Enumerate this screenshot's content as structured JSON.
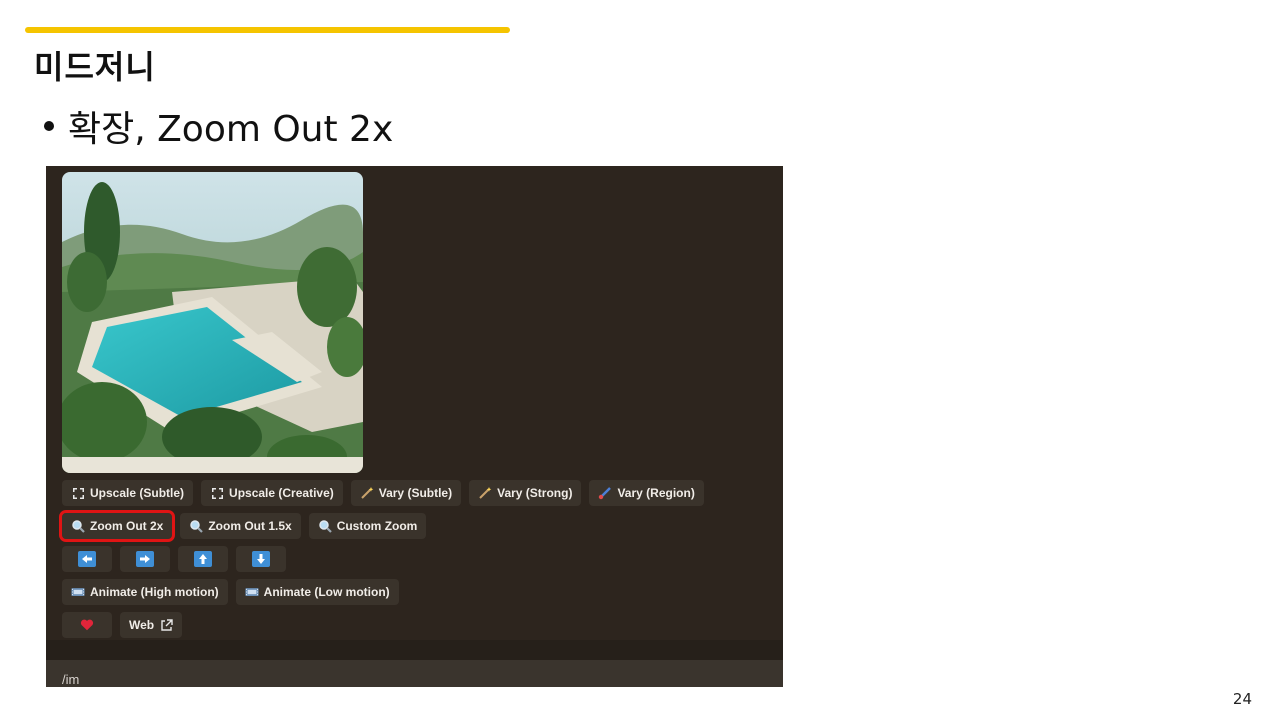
{
  "slide": {
    "title": "미드저니",
    "bullet": "확장, Zoom Out 2x",
    "page_number": "24",
    "accent_color": "#f5c400"
  },
  "screenshot": {
    "background": "#2d251e",
    "image": {
      "description_icon": "generated-image",
      "alt": ""
    },
    "rows": [
      [
        {
          "icon": "upscale-icon",
          "label": "Upscale (Subtle)"
        },
        {
          "icon": "upscale-icon",
          "label": "Upscale (Creative)"
        },
        {
          "icon": "magic-wand-icon",
          "label": "Vary (Subtle)"
        },
        {
          "icon": "magic-wand-icon",
          "label": "Vary (Strong)"
        },
        {
          "icon": "paintbrush-icon",
          "label": "Vary (Region)"
        }
      ],
      [
        {
          "icon": "magnifier-icon",
          "label": "Zoom Out 2x",
          "highlighted": true
        },
        {
          "icon": "magnifier-icon",
          "label": "Zoom Out 1.5x"
        },
        {
          "icon": "magnifier-icon",
          "label": "Custom Zoom"
        }
      ],
      [
        {
          "icon": "arrow-left-icon",
          "label": ""
        },
        {
          "icon": "arrow-right-icon",
          "label": ""
        },
        {
          "icon": "arrow-up-icon",
          "label": ""
        },
        {
          "icon": "arrow-down-icon",
          "label": ""
        }
      ],
      [
        {
          "icon": "film-icon",
          "label": "Animate (High motion)"
        },
        {
          "icon": "film-icon",
          "label": "Animate (Low motion)"
        }
      ],
      [
        {
          "icon": "heart-icon",
          "label": ""
        },
        {
          "icon": "external-link-icon",
          "label": "Web"
        }
      ]
    ],
    "highlight_color": "#e01414",
    "input_text": "/im"
  }
}
